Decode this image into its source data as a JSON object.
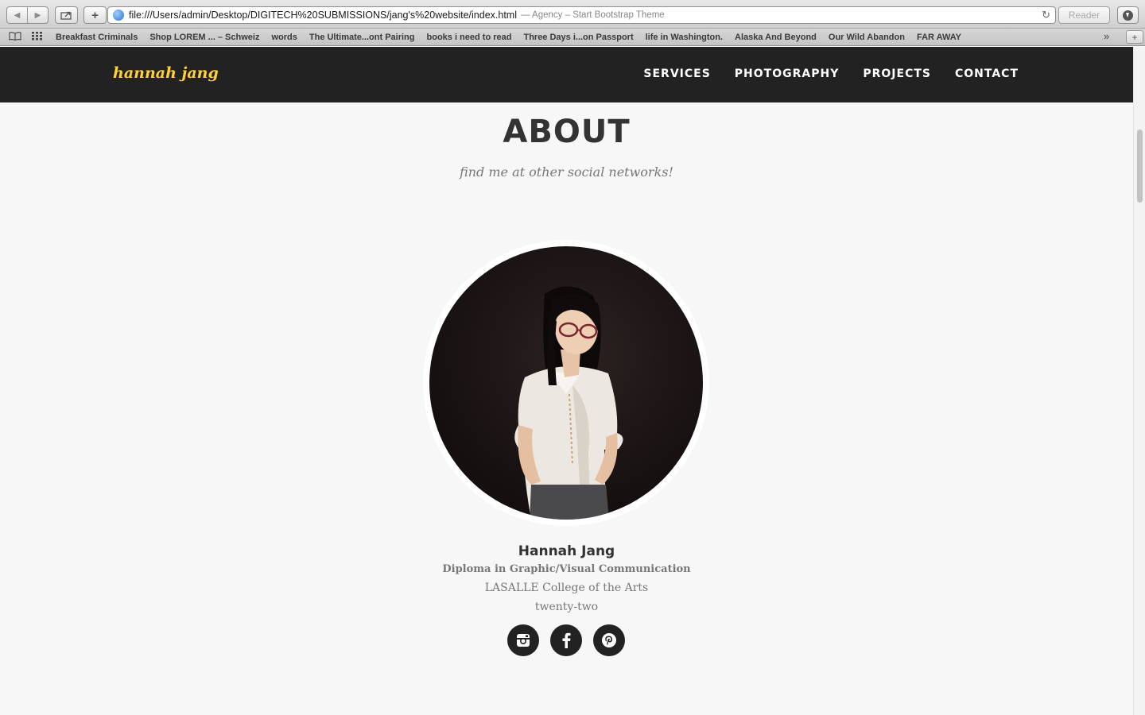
{
  "browser": {
    "url": "file:///Users/admin/Desktop/DIGITECH%20SUBMISSIONS/jang's%20website/index.html",
    "page_title": "— Agency – Start Bootstrap Theme",
    "reader_label": "Reader",
    "bookmarks": [
      "Breakfast Criminals",
      "Shop LOREM ... – Schweiz",
      "words",
      "The Ultimate...ont Pairing",
      "books i need to read",
      "Three Days i...on Passport",
      "life in Washington.",
      "Alaska And Beyond",
      "Our Wild Abandon",
      "FAR AWAY"
    ]
  },
  "site": {
    "brand": "hannah jang",
    "brand_color": "#fed136",
    "nav": [
      "SERVICES",
      "PHOTOGRAPHY",
      "PROJECTS",
      "CONTACT"
    ]
  },
  "about": {
    "title": "ABOUT",
    "subtitle": "find me at other social networks!",
    "name": "Hannah Jang",
    "degree": "Diploma in Graphic/Visual Communication",
    "college": "LASALLE College of the Arts",
    "age": "twenty-two",
    "social": [
      "instagram-icon",
      "facebook-icon",
      "pinterest-icon"
    ]
  }
}
